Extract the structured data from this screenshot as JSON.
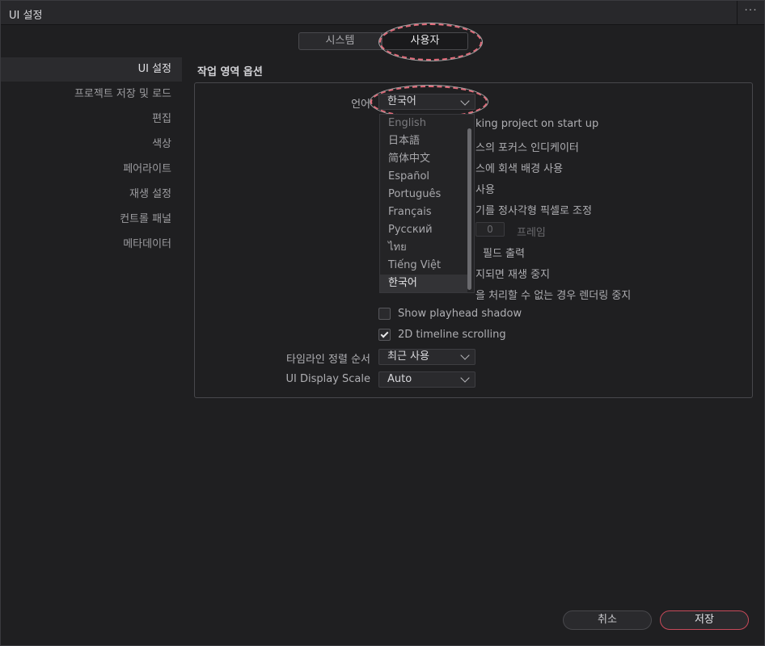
{
  "window": {
    "title": "UI 설정",
    "more_label": "···"
  },
  "tabs": {
    "system": "시스템",
    "user": "사용자"
  },
  "sidebar": {
    "items": [
      {
        "label": "UI 설정"
      },
      {
        "label": "프로젝트 저장 및 로드"
      },
      {
        "label": "편집"
      },
      {
        "label": "색상"
      },
      {
        "label": "페어라이트"
      },
      {
        "label": "재생 설정"
      },
      {
        "label": "컨트롤 패널"
      },
      {
        "label": "메타데이터"
      }
    ]
  },
  "main": {
    "section_title": "작업 영역 옵션",
    "language_label": "언어",
    "language_value": "한국어",
    "options_partial": [
      "king project on start up",
      "스의 포커스 인디케이터",
      "스에 회색 배경 사용",
      " 사용",
      "기를 정사각형 픽셀로 조정",
      "필드 출력",
      "지되면 재생 중지",
      "을 처리할 수 없는 경우 렌더링 중지"
    ],
    "frames_value": "0",
    "frames_unit": "프레임",
    "show_playhead_shadow": "Show playhead shadow",
    "timeline_scrolling": "2D timeline scrolling",
    "timeline_sort_label": "타임라인 정렬 순서",
    "timeline_sort_value": "최근 사용",
    "ui_scale_label": "UI Display Scale",
    "ui_scale_value": "Auto"
  },
  "language_menu": {
    "options": [
      "English",
      "日本語",
      "简体中文",
      "Español",
      "Português",
      "Français",
      "Русский",
      "ไทย",
      "Tiếng Việt",
      "한국어"
    ],
    "selected": "한국어"
  },
  "footer": {
    "cancel": "취소",
    "save": "저장"
  },
  "colors": {
    "accent": "#c84a5a",
    "annotation": "#e36b7a"
  }
}
